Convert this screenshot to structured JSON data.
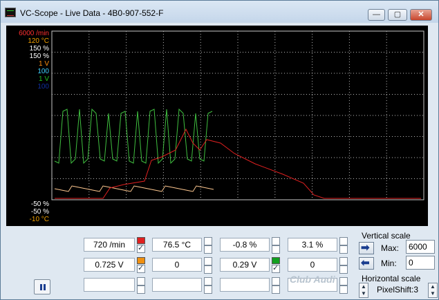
{
  "window": {
    "title": "VC-Scope  -  Live Data  -  4B0-907-552-F",
    "minimize_label": "—",
    "maximize_label": "▢",
    "close_label": "✕"
  },
  "scope": {
    "scale_labels_top": [
      {
        "text": "6000 /min",
        "color": "#ff3030"
      },
      {
        "text": "120 °C",
        "color": "#f0a000"
      },
      {
        "text": "150 %",
        "color": "#ffffff"
      },
      {
        "text": "150 %",
        "color": "#ffffff"
      },
      {
        "text": "1 V",
        "color": "#ff9010"
      },
      {
        "text": "100",
        "color": "#40d0ff"
      },
      {
        "text": "1 V",
        "color": "#20c020"
      },
      {
        "text": "100",
        "color": "#1030a0"
      }
    ],
    "scale_labels_bottom": [
      {
        "text": "-50 %",
        "color": "#ffffff"
      },
      {
        "text": "-50 %",
        "color": "#ffffff"
      },
      {
        "text": "-10 °C",
        "color": "#f0a000"
      }
    ]
  },
  "channels": {
    "row1": [
      {
        "value": "720 /min",
        "checked": true,
        "color": "#e02020"
      },
      {
        "value": "76.5 °C",
        "checked": false,
        "color": ""
      },
      {
        "value": "-0.8 %",
        "checked": false,
        "color": ""
      },
      {
        "value": "3.1 %",
        "checked": false,
        "color": ""
      }
    ],
    "row2": [
      {
        "value": "0.725 V",
        "checked": true,
        "color": "#f09010"
      },
      {
        "value": "0",
        "checked": false,
        "color": ""
      },
      {
        "value": "0.29 V",
        "checked": true,
        "color": "#10a020"
      },
      {
        "value": "0",
        "checked": false,
        "color": ""
      }
    ],
    "row3": [
      {
        "value": ""
      },
      {
        "value": ""
      },
      {
        "value": ""
      },
      {
        "value": ""
      }
    ]
  },
  "vertical_scale": {
    "title": "Vertical scale",
    "max_label": "Max:",
    "max_value": "6000",
    "min_label": "Min:",
    "min_value": "0"
  },
  "horizontal_scale": {
    "title": "Horizontal scale",
    "pixelshift_label": "PixelShift:3"
  },
  "watermark": "Club Audi",
  "icons": {
    "pause": "pause-icon",
    "right_arrow": "arrow-right-icon",
    "left_arrow": "arrow-left-icon",
    "spinner": "spinner-icon"
  }
}
